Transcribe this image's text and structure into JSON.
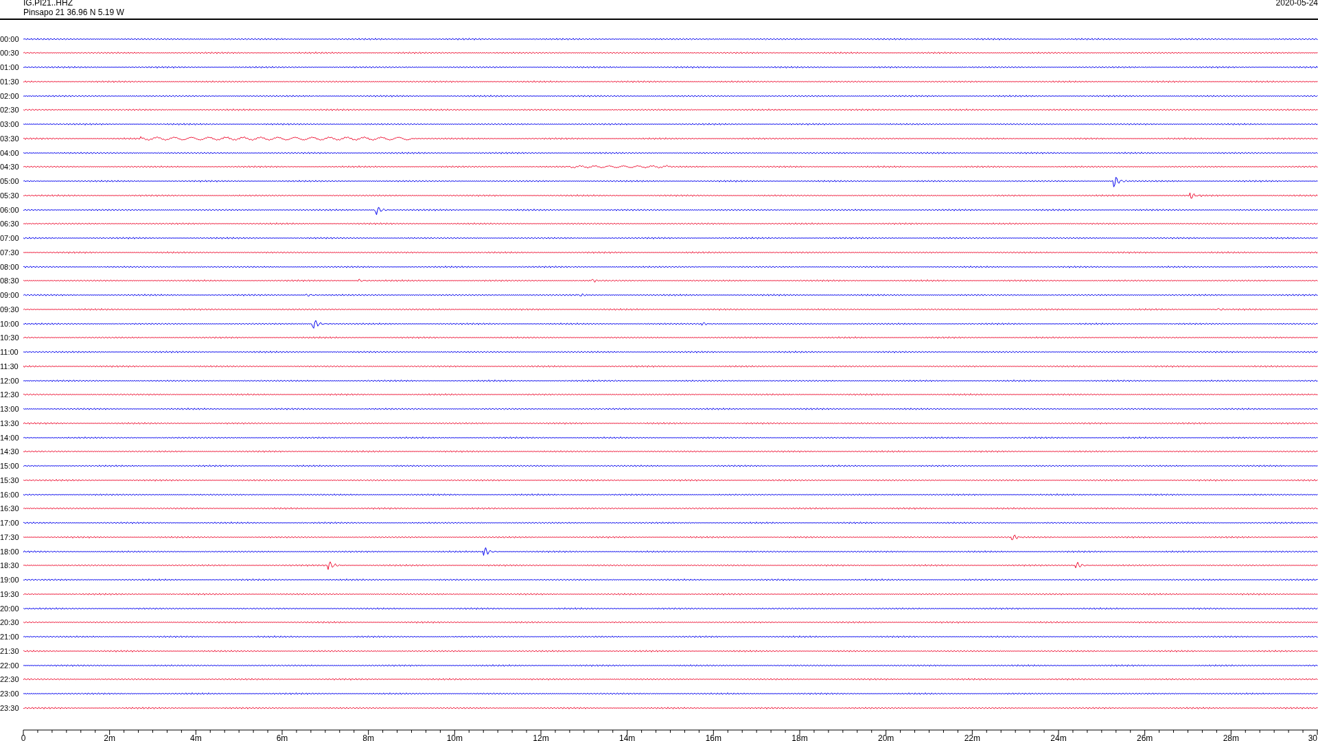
{
  "header": {
    "channel": "IG.PI21..HHZ",
    "station": "Pinsapo 21  36.96 N 5.19 W",
    "date": "2020-05-24"
  },
  "rows": [
    {
      "label": "00:00",
      "color": "#0000ee"
    },
    {
      "label": "00:30",
      "color": "#ee1133"
    },
    {
      "label": "01:00",
      "color": "#0000ee"
    },
    {
      "label": "01:30",
      "color": "#ee1133"
    },
    {
      "label": "02:00",
      "color": "#0000ee"
    },
    {
      "label": "02:30",
      "color": "#ee1133"
    },
    {
      "label": "03:00",
      "color": "#0000ee"
    },
    {
      "label": "03:30",
      "color": "#ee1133"
    },
    {
      "label": "04:00",
      "color": "#0000ee"
    },
    {
      "label": "04:30",
      "color": "#ee1133"
    },
    {
      "label": "05:00",
      "color": "#0000ee"
    },
    {
      "label": "05:30",
      "color": "#ee1133"
    },
    {
      "label": "06:00",
      "color": "#0000ee"
    },
    {
      "label": "06:30",
      "color": "#ee1133"
    },
    {
      "label": "07:00",
      "color": "#0000ee"
    },
    {
      "label": "07:30",
      "color": "#ee1133"
    },
    {
      "label": "08:00",
      "color": "#0000ee"
    },
    {
      "label": "08:30",
      "color": "#ee1133"
    },
    {
      "label": "09:00",
      "color": "#0000ee"
    },
    {
      "label": "09:30",
      "color": "#ee1133"
    },
    {
      "label": "10:00",
      "color": "#0000ee"
    },
    {
      "label": "10:30",
      "color": "#ee1133"
    },
    {
      "label": "11:00",
      "color": "#0000ee"
    },
    {
      "label": "11:30",
      "color": "#ee1133"
    },
    {
      "label": "12:00",
      "color": "#0000ee"
    },
    {
      "label": "12:30",
      "color": "#ee1133"
    },
    {
      "label": "13:00",
      "color": "#0000ee"
    },
    {
      "label": "13:30",
      "color": "#ee1133"
    },
    {
      "label": "14:00",
      "color": "#0000ee"
    },
    {
      "label": "14:30",
      "color": "#ee1133"
    },
    {
      "label": "15:00",
      "color": "#0000ee"
    },
    {
      "label": "15:30",
      "color": "#ee1133"
    },
    {
      "label": "16:00",
      "color": "#0000ee"
    },
    {
      "label": "16:30",
      "color": "#ee1133"
    },
    {
      "label": "17:00",
      "color": "#0000ee"
    },
    {
      "label": "17:30",
      "color": "#ee1133"
    },
    {
      "label": "18:00",
      "color": "#0000ee"
    },
    {
      "label": "18:30",
      "color": "#ee1133"
    },
    {
      "label": "19:00",
      "color": "#0000ee"
    },
    {
      "label": "19:30",
      "color": "#ee1133"
    },
    {
      "label": "20:00",
      "color": "#0000ee"
    },
    {
      "label": "20:30",
      "color": "#ee1133"
    },
    {
      "label": "21:00",
      "color": "#0000ee"
    },
    {
      "label": "21:30",
      "color": "#ee1133"
    },
    {
      "label": "22:00",
      "color": "#0000ee"
    },
    {
      "label": "22:30",
      "color": "#ee1133"
    },
    {
      "label": "23:00",
      "color": "#0000ee"
    },
    {
      "label": "23:30",
      "color": "#ee1133"
    }
  ],
  "axis": {
    "ticks": [
      "0",
      "2m",
      "4m",
      "6m",
      "8m",
      "10m",
      "12m",
      "14m",
      "16m",
      "18m",
      "20m",
      "22m",
      "24m",
      "26m",
      "28m",
      "30"
    ]
  }
}
